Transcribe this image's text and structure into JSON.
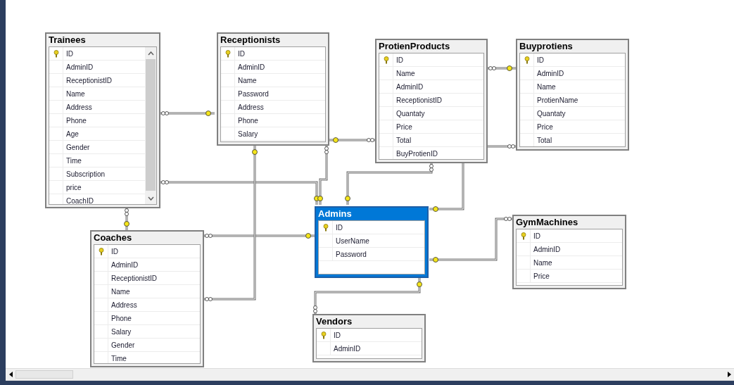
{
  "diagram": {
    "tables": [
      {
        "name": "Trainees",
        "selected": false,
        "columns": [
          {
            "name": "ID",
            "primary_key": true
          },
          {
            "name": "AdminID",
            "primary_key": false
          },
          {
            "name": "ReceptionistID",
            "primary_key": false
          },
          {
            "name": "Name",
            "primary_key": false
          },
          {
            "name": "Address",
            "primary_key": false
          },
          {
            "name": "Phone",
            "primary_key": false
          },
          {
            "name": "Age",
            "primary_key": false
          },
          {
            "name": "Gender",
            "primary_key": false
          },
          {
            "name": "Time",
            "primary_key": false
          },
          {
            "name": "Subscription",
            "primary_key": false
          },
          {
            "name": "price",
            "primary_key": false
          },
          {
            "name": "CoachID",
            "primary_key": false
          }
        ]
      },
      {
        "name": "Receptionists",
        "selected": false,
        "columns": [
          {
            "name": "ID",
            "primary_key": true
          },
          {
            "name": "AdminID",
            "primary_key": false
          },
          {
            "name": "Name",
            "primary_key": false
          },
          {
            "name": "Password",
            "primary_key": false
          },
          {
            "name": "Address",
            "primary_key": false
          },
          {
            "name": "Phone",
            "primary_key": false
          },
          {
            "name": "Salary",
            "primary_key": false
          }
        ]
      },
      {
        "name": "ProtienProducts",
        "selected": false,
        "columns": [
          {
            "name": "ID",
            "primary_key": true
          },
          {
            "name": "Name",
            "primary_key": false
          },
          {
            "name": "AdminID",
            "primary_key": false
          },
          {
            "name": "ReceptionistID",
            "primary_key": false
          },
          {
            "name": "Quantaty",
            "primary_key": false
          },
          {
            "name": "Price",
            "primary_key": false
          },
          {
            "name": "Total",
            "primary_key": false
          },
          {
            "name": "BuyProtienID",
            "primary_key": false
          }
        ]
      },
      {
        "name": "Buyprotiens",
        "selected": false,
        "columns": [
          {
            "name": "ID",
            "primary_key": true
          },
          {
            "name": "AdminID",
            "primary_key": false
          },
          {
            "name": "Name",
            "primary_key": false
          },
          {
            "name": "ProtienName",
            "primary_key": false
          },
          {
            "name": "Quantaty",
            "primary_key": false
          },
          {
            "name": "Price",
            "primary_key": false
          },
          {
            "name": "Total",
            "primary_key": false
          }
        ]
      },
      {
        "name": "Admins",
        "selected": true,
        "columns": [
          {
            "name": "ID",
            "primary_key": true
          },
          {
            "name": "UserName",
            "primary_key": false
          },
          {
            "name": "Password",
            "primary_key": false
          }
        ]
      },
      {
        "name": "GymMachines",
        "selected": false,
        "columns": [
          {
            "name": "ID",
            "primary_key": true
          },
          {
            "name": "AdminID",
            "primary_key": false
          },
          {
            "name": "Name",
            "primary_key": false
          },
          {
            "name": "Price",
            "primary_key": false
          }
        ]
      },
      {
        "name": "Coaches",
        "selected": false,
        "columns": [
          {
            "name": "ID",
            "primary_key": true
          },
          {
            "name": "AdminID",
            "primary_key": false
          },
          {
            "name": "ReceptionistID",
            "primary_key": false
          },
          {
            "name": "Name",
            "primary_key": false
          },
          {
            "name": "Address",
            "primary_key": false
          },
          {
            "name": "Phone",
            "primary_key": false
          },
          {
            "name": "Salary",
            "primary_key": false
          },
          {
            "name": "Gender",
            "primary_key": false
          },
          {
            "name": "Time",
            "primary_key": false
          }
        ]
      },
      {
        "name": "Vendors",
        "selected": false,
        "columns": [
          {
            "name": "ID",
            "primary_key": true
          },
          {
            "name": "AdminID",
            "primary_key": false
          }
        ]
      }
    ]
  }
}
